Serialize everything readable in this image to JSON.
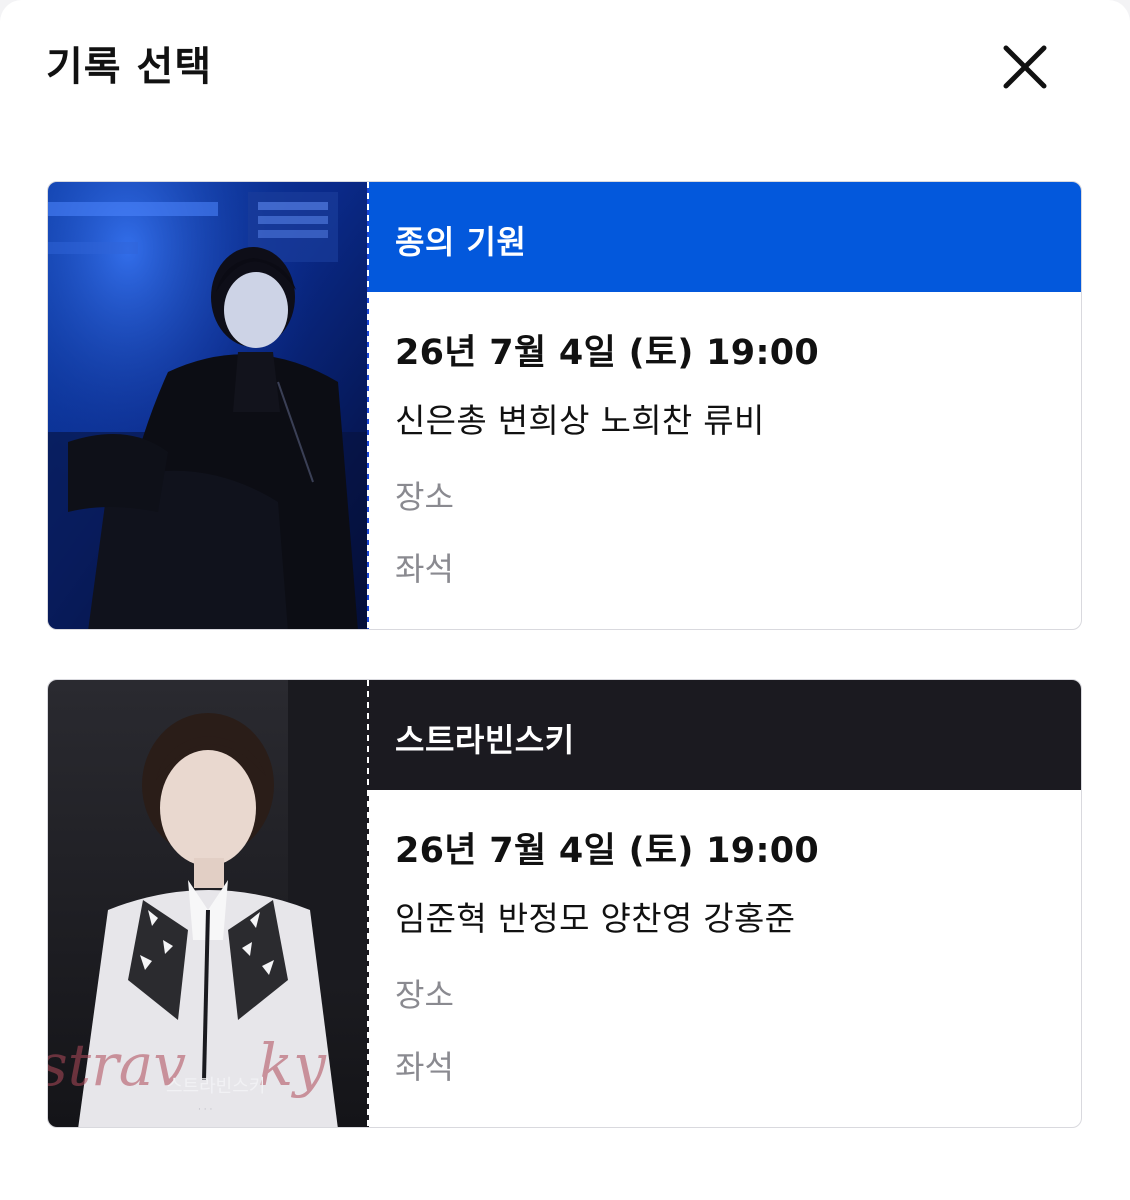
{
  "header": {
    "title": "기록 선택",
    "close_icon": "close-icon"
  },
  "colors": {
    "card1_band": "#0358dc",
    "card2_band": "#1b1a20",
    "muted_text": "#8a8a90"
  },
  "records": [
    {
      "title": "종의 기원",
      "datetime": "26년 7월 4일 (토) 19:00",
      "cast": "신은총 변희상 노희찬 류비",
      "venue_label": "장소",
      "seat_label": "좌석",
      "poster": "poster-image"
    },
    {
      "title": "스트라빈스키",
      "datetime": "26년 7월 4일 (토) 19:00",
      "cast": "임준혁 반정모 양찬영 강홍준",
      "venue_label": "장소",
      "seat_label": "좌석",
      "poster": "poster-image",
      "poster_text": "스트라빈스키"
    }
  ]
}
